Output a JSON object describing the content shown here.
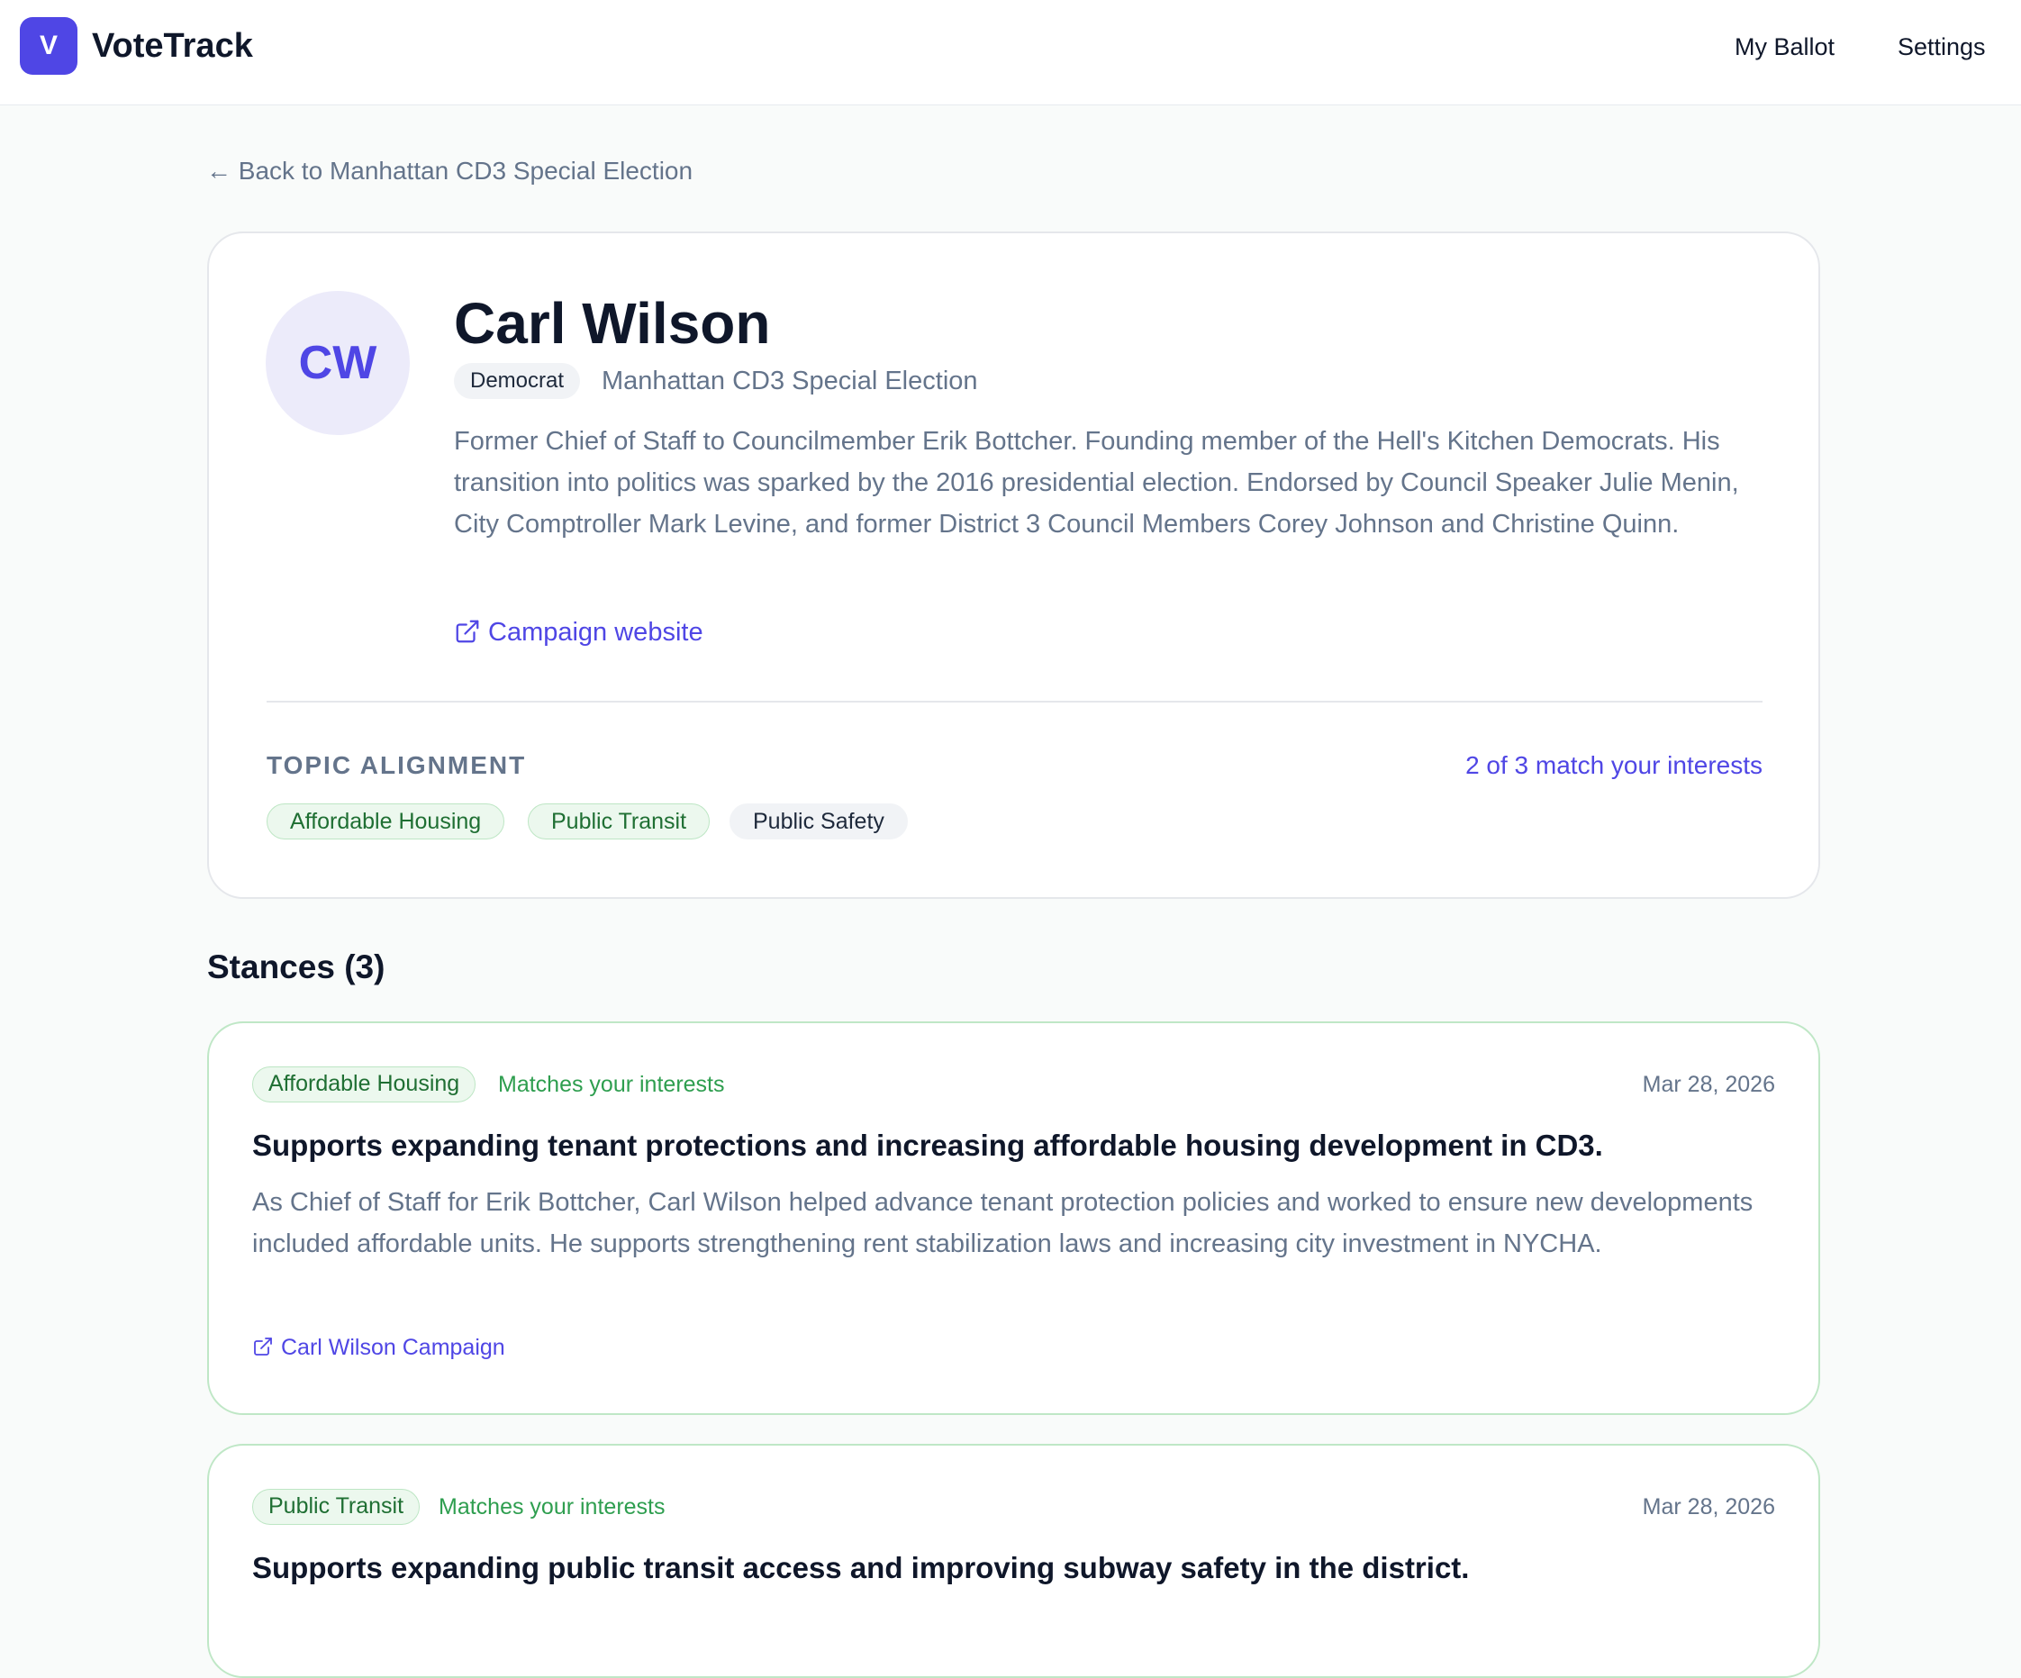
{
  "app": {
    "logo_letter": "V",
    "title": "VoteTrack",
    "nav": [
      "My Ballot",
      "Settings"
    ],
    "accent_color": "#4f46e5"
  },
  "back_link": "← Back to Manhattan CD3 Special Election",
  "candidate": {
    "initials": "CW",
    "name": "Carl Wilson",
    "party": "Democrat",
    "election": "Manhattan CD3 Special Election",
    "bio": "Former Chief of Staff to Councilmember Erik Bottcher. Founding member of the Hell's Kitchen Democrats. His transition into politics was sparked by the 2016 presidential election. Endorsed by Council Speaker Julie Menin, City Comptroller Mark Levine, and former District 3 Council Members Corey Johnson and Christine Quinn.",
    "campaign_link": "Campaign website"
  },
  "topic_alignment": {
    "label": "TOPIC ALIGNMENT",
    "summary": "2 of 3 match your interests",
    "topics": [
      {
        "label": "Affordable Housing",
        "matched": true
      },
      {
        "label": "Public Transit",
        "matched": true
      },
      {
        "label": "Public Safety",
        "matched": false
      }
    ]
  },
  "stances": {
    "title": "Stances (3)",
    "items": [
      {
        "topic": "Affordable Housing",
        "match_note": "Matches your interests",
        "date": "Mar 28, 2026",
        "headline": "Supports expanding tenant protections and increasing affordable housing development in CD3.",
        "body": "As Chief of Staff for Erik Bottcher, Carl Wilson helped advance tenant protection policies and worked to ensure new developments included affordable units. He supports strengthening rent stabilization laws and increasing city investment in NYCHA.",
        "source": "Carl Wilson Campaign"
      },
      {
        "topic": "Public Transit",
        "match_note": "Matches your interests",
        "date": "Mar 28, 2026",
        "headline": "Supports expanding public transit access and improving subway safety in the district."
      }
    ]
  }
}
